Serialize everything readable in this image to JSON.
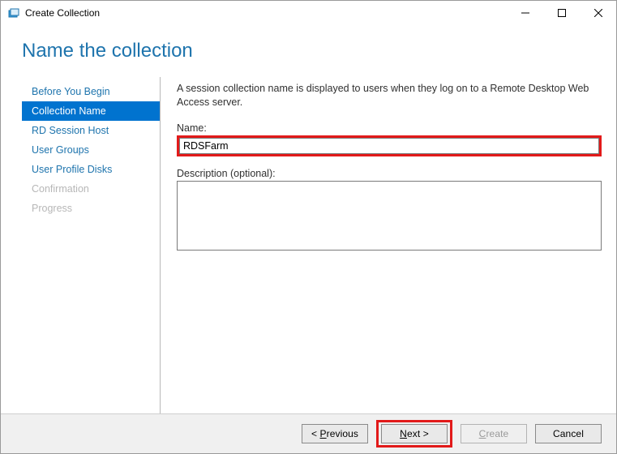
{
  "window": {
    "title": "Create Collection"
  },
  "heading": "Name the collection",
  "sidebar": {
    "steps": [
      {
        "label": "Before You Begin",
        "state": "normal"
      },
      {
        "label": "Collection Name",
        "state": "selected"
      },
      {
        "label": "RD Session Host",
        "state": "normal"
      },
      {
        "label": "User Groups",
        "state": "normal"
      },
      {
        "label": "User Profile Disks",
        "state": "normal"
      },
      {
        "label": "Confirmation",
        "state": "disabled"
      },
      {
        "label": "Progress",
        "state": "disabled"
      }
    ]
  },
  "content": {
    "intro": "A session collection name is displayed to users when they log on to a Remote Desktop Web Access server.",
    "name_label": "Name:",
    "name_value": "RDSFarm",
    "desc_label": "Description (optional):",
    "desc_value": ""
  },
  "footer": {
    "previous_prefix": "< ",
    "previous_hot": "P",
    "previous_rest": "revious",
    "next_hot": "N",
    "next_rest": "ext >",
    "create_hot": "C",
    "create_rest": "reate",
    "cancel": "Cancel"
  }
}
